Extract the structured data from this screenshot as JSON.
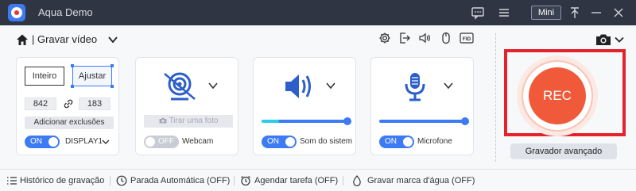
{
  "window": {
    "app_title": "Aqua Demo",
    "mini_label": "Mini",
    "icons": [
      "app-logo-icon",
      "chat-icon",
      "menu-icon",
      "pin-icon",
      "minimize-icon",
      "close-icon"
    ]
  },
  "toolbar": {
    "mode_title": "| Gravar vídeo",
    "tool_icons": [
      "settings-icon",
      "export-icon",
      "volume-icon",
      "mouse-icon",
      "fid-icon"
    ],
    "fid_label": "FID"
  },
  "display_card": {
    "inteiro_label": "Inteiro",
    "ajustar_label": "Ajustar",
    "width_value": "842",
    "height_value": "183",
    "exclusions_label": "Adicionar exclusões",
    "toggle_label": "ON",
    "display_label": "DISPLAY1"
  },
  "webcam_card": {
    "photo_label": "Tirar uma foto",
    "toggle_label": "OFF",
    "card_label": "Webcam"
  },
  "sound_card": {
    "toggle_label": "ON",
    "card_label": "Som do sistem",
    "volume": 1.0
  },
  "mic_card": {
    "toggle_label": "ON",
    "card_label": "Microfone",
    "volume": 1.0
  },
  "rec": {
    "rec_label": "REC",
    "advanced_label": "Gravador avançado"
  },
  "bottom_bar": {
    "history_label": "Histórico de gravação",
    "auto_stop_label": "Parada Automática (OFF)",
    "schedule_label": "Agendar tarefa (OFF)",
    "watermark_label": "Gravar marca d'água (OFF)"
  },
  "colors": {
    "accent": "#3d7bf4",
    "rec": "#f05a3a",
    "highlight_frame": "#e4222b",
    "titlebar": "#2f3542"
  }
}
